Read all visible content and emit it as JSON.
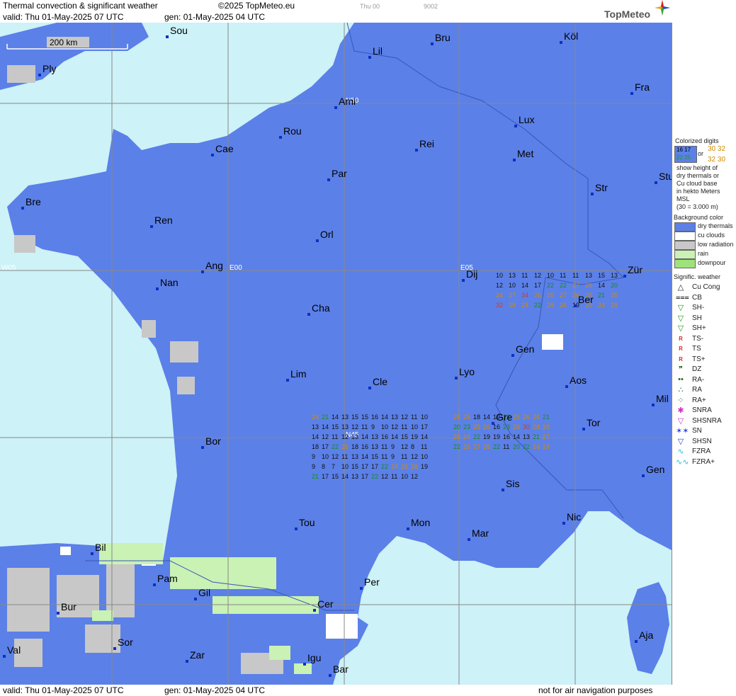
{
  "header": {
    "title": "Thermal convection & significant weather",
    "copyright": "©2025 TopMeteo.eu",
    "tag1": "Thu 00",
    "tag2": "9002",
    "valid": "valid:  Thu  01-May-2025  07 UTC",
    "gen": "gen: 01-May-2025 04 UTC",
    "logo": "TopMeteo"
  },
  "footer": {
    "valid": "valid:  Thu  01-May-2025  07 UTC",
    "gen": "gen: 01-May-2025 04 UTC",
    "note": "not for air navigation purposes"
  },
  "map": {
    "scale_label": "200 km",
    "grid_labels": [
      "N50",
      "N45",
      "W05",
      "E00",
      "E05"
    ],
    "cities": [
      {
        "name": "Sou"
      },
      {
        "name": "Ply"
      },
      {
        "name": "Lil"
      },
      {
        "name": "Bru"
      },
      {
        "name": "Köl"
      },
      {
        "name": "Ami"
      },
      {
        "name": "Fra"
      },
      {
        "name": "Rou"
      },
      {
        "name": "Lux"
      },
      {
        "name": "Cae"
      },
      {
        "name": "Rei"
      },
      {
        "name": "Met"
      },
      {
        "name": "Par"
      },
      {
        "name": "Stu"
      },
      {
        "name": "Bre"
      },
      {
        "name": "Str"
      },
      {
        "name": "Ren"
      },
      {
        "name": "Orl"
      },
      {
        "name": "Ang"
      },
      {
        "name": "Dij"
      },
      {
        "name": "Zür"
      },
      {
        "name": "Nan"
      },
      {
        "name": "Ber"
      },
      {
        "name": "Cha"
      },
      {
        "name": "Gen"
      },
      {
        "name": "Lim"
      },
      {
        "name": "Cle"
      },
      {
        "name": "Lyo"
      },
      {
        "name": "Aos"
      },
      {
        "name": "Mil"
      },
      {
        "name": "Gre"
      },
      {
        "name": "Tor"
      },
      {
        "name": "Bor"
      },
      {
        "name": "Gen"
      },
      {
        "name": "Sis"
      },
      {
        "name": "Tou"
      },
      {
        "name": "Mon"
      },
      {
        "name": "Nic"
      },
      {
        "name": "Mar"
      },
      {
        "name": "Bil"
      },
      {
        "name": "Pam"
      },
      {
        "name": "Per"
      },
      {
        "name": "Gil"
      },
      {
        "name": "Bur"
      },
      {
        "name": "Cer"
      },
      {
        "name": "Sor"
      },
      {
        "name": "Aja"
      },
      {
        "name": "Val"
      },
      {
        "name": "Zar"
      },
      {
        "name": "Igu"
      },
      {
        "name": "Bar"
      }
    ]
  },
  "legend": {
    "colorized_title": "Colorized digits",
    "digits_a": "16 17",
    "digits_b": "22 25",
    "or": "or",
    "digits_c": "30 32",
    "digits_d": "32 30",
    "desc": [
      "show height of",
      "dry thermals or",
      "Cu cloud base",
      "in hekto Meters",
      "MSL",
      "(30 = 3.000 m)"
    ],
    "bg_title": "Background color",
    "bg_items": [
      {
        "label": "dry thermals",
        "color": "#5b80e8"
      },
      {
        "label": "cu clouds",
        "color": "#ffffff"
      },
      {
        "label": "low radiation",
        "color": "#c8c8c8"
      },
      {
        "label": "rain",
        "color": "#c9f2b4"
      },
      {
        "label": "downpour",
        "color": "#9ee27c"
      }
    ],
    "wx_title": "Signific. weather",
    "wx_items": [
      {
        "label": "Cu Cong",
        "icon": "cu-cong-icon",
        "color": "#222222"
      },
      {
        "label": "CB",
        "icon": "cb-icon",
        "color": "#222222"
      },
      {
        "label": "SH-",
        "icon": "shower-light-icon",
        "color": "#1f9a1f"
      },
      {
        "label": "SH",
        "icon": "shower-icon",
        "color": "#1f9a1f"
      },
      {
        "label": "SH+",
        "icon": "shower-heavy-icon",
        "color": "#1f9a1f"
      },
      {
        "label": "TS-",
        "icon": "thunder-light-icon",
        "color": "#d01010"
      },
      {
        "label": "TS",
        "icon": "thunder-icon",
        "color": "#d01010"
      },
      {
        "label": "TS+",
        "icon": "thunder-heavy-icon",
        "color": "#d01010"
      },
      {
        "label": "DZ",
        "icon": "drizzle-icon",
        "color": "#1a6a1a"
      },
      {
        "label": "RA-",
        "icon": "rain-light-icon",
        "color": "#1a6a1a"
      },
      {
        "label": "RA",
        "icon": "rain-icon",
        "color": "#1a6a1a"
      },
      {
        "label": "RA+",
        "icon": "rain-heavy-icon",
        "color": "#1a6a1a"
      },
      {
        "label": "SNRA",
        "icon": "snow-rain-icon",
        "color": "#cc33cc"
      },
      {
        "label": "SHSNRA",
        "icon": "snow-rain-shower-icon",
        "color": "#cc33cc"
      },
      {
        "label": "SN",
        "icon": "snow-icon",
        "color": "#2244dd"
      },
      {
        "label": "SHSN",
        "icon": "snow-shower-icon",
        "color": "#2244dd"
      },
      {
        "label": "FZRA",
        "icon": "freezing-rain-icon",
        "color": "#22bbdd"
      },
      {
        "label": "FZRA+",
        "icon": "freezing-rain-heavy-icon",
        "color": "#22bbdd"
      }
    ]
  },
  "thermal_values": [
    "10",
    "13",
    "11",
    "12",
    "10",
    "11",
    "11",
    "13",
    "15",
    "13",
    "12",
    "10",
    "14",
    "17",
    "22",
    "22",
    "27",
    "26",
    "14",
    "20",
    "24",
    "27",
    "34",
    "26",
    "25",
    "27",
    "26",
    "25",
    "21",
    "25",
    "32",
    "28",
    "28",
    "22",
    "28",
    "26",
    "19",
    "29",
    "24",
    "29",
    "25",
    "25",
    "18",
    "14",
    "19",
    "22",
    "25",
    "26",
    "26",
    "21",
    "20",
    "23",
    "25",
    "26",
    "16",
    "23",
    "26",
    "30",
    "28",
    "29",
    "26",
    "24",
    "22",
    "19",
    "19",
    "16",
    "14",
    "13",
    "21",
    "27",
    "22",
    "26",
    "27",
    "26",
    "22",
    "11",
    "20",
    "22",
    "24",
    "24",
    "24",
    "21",
    "14",
    "13",
    "15",
    "15",
    "16",
    "14",
    "13",
    "12",
    "11",
    "10",
    "13",
    "14",
    "15",
    "13",
    "12",
    "11",
    "9",
    "10",
    "12",
    "11",
    "10",
    "17",
    "14",
    "12",
    "11",
    "12",
    "13",
    "14",
    "13",
    "16",
    "14",
    "15",
    "19",
    "14",
    "18",
    "17",
    "22",
    "26",
    "18",
    "16",
    "13",
    "11",
    "9",
    "12",
    "8",
    "11",
    "9",
    "10",
    "12",
    "11",
    "13",
    "14",
    "15",
    "11",
    "9",
    "11",
    "12",
    "10",
    "9",
    "8",
    "7",
    "10",
    "15",
    "17",
    "17",
    "22",
    "24",
    "28",
    "26",
    "19",
    "21",
    "17",
    "15",
    "14",
    "13",
    "17",
    "22",
    "12",
    "11",
    "10",
    "12"
  ]
}
